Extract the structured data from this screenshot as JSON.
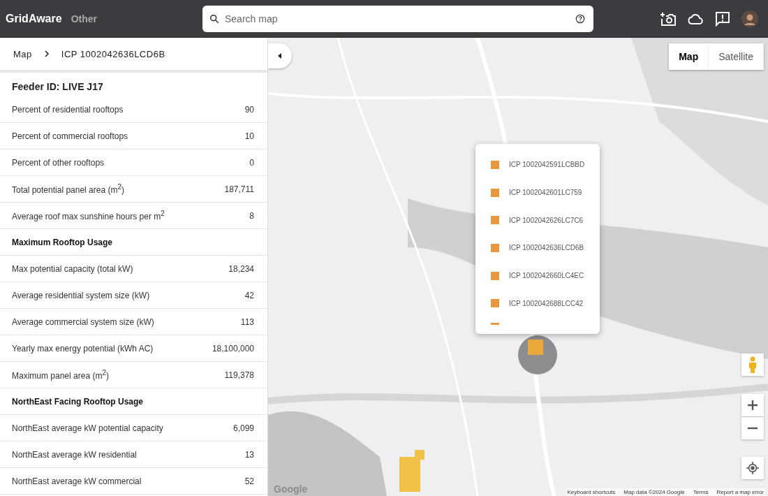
{
  "header": {
    "brand": "GridAware",
    "nav": "Other",
    "search": {
      "placeholder": "Search map"
    }
  },
  "breadcrumb": {
    "root": "Map",
    "current": "ICP 1002042636LCD6B"
  },
  "panel": {
    "title": "Feeder ID: LIVE J17",
    "rows": [
      {
        "kind": "row",
        "label": "Percent of residential rooftops",
        "value": "90"
      },
      {
        "kind": "row",
        "label": "Percent of commercial rooftops",
        "value": "10"
      },
      {
        "kind": "row",
        "label": "Percent of other rooftops",
        "value": "0"
      },
      {
        "kind": "row",
        "label": "Total potential panel area (m$^{2}$)",
        "value": "187,711"
      },
      {
        "kind": "row",
        "label": "Average roof max sunshine hours per m$^{2}$",
        "value": "8"
      },
      {
        "kind": "heading",
        "label": "Maximum Rooftop Usage"
      },
      {
        "kind": "row",
        "label": "Max potential capacity (total kW)",
        "value": "18,234"
      },
      {
        "kind": "row",
        "label": "Average residential system size (kW)",
        "value": "42"
      },
      {
        "kind": "row",
        "label": "Average commercial system size (kW)",
        "value": "113"
      },
      {
        "kind": "row",
        "label": "Yearly max energy potential (kWh AC)",
        "value": "18,100,000"
      },
      {
        "kind": "row",
        "label": "Maximum panel area (m$^{2}$)",
        "value": "119,378"
      },
      {
        "kind": "heading",
        "label": "NorthEast Facing Rooftop Usage"
      },
      {
        "kind": "row",
        "label": "NorthEast average kW potential capacity",
        "value": "6,099"
      },
      {
        "kind": "row",
        "label": "NorthEast average kW residential",
        "value": "13"
      },
      {
        "kind": "row",
        "label": "NorthEast average kW commercial",
        "value": "52"
      }
    ]
  },
  "map": {
    "kind": "picture",
    "types": [
      {
        "label": "Map",
        "selected": true
      },
      {
        "label": "Satellite",
        "selected": false
      }
    ],
    "popup": [
      "ICP 1002042591LCBBD",
      "ICP 1002042601LC759",
      "ICP 1002042626LC7C6",
      "ICP 1002042636LCD6B",
      "ICP 1002042660LC4EC",
      "ICP 1002042688LCC42"
    ],
    "logo": "Google",
    "footer": [
      "Keyboard shortcuts",
      "Map data ©2024 Google",
      "Terms",
      "Report a map error"
    ]
  }
}
